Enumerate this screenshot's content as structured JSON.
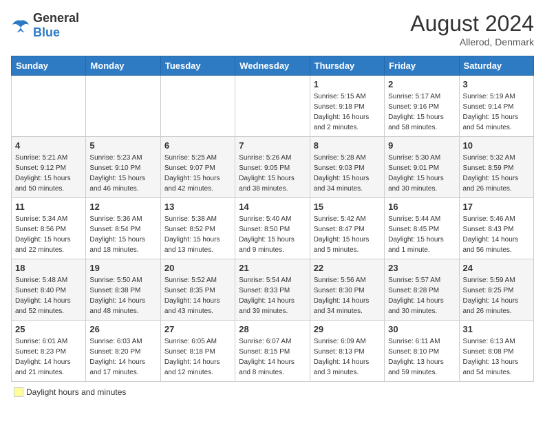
{
  "logo": {
    "general": "General",
    "blue": "Blue"
  },
  "header": {
    "month_year": "August 2024",
    "location": "Allerod, Denmark"
  },
  "days_of_week": [
    "Sunday",
    "Monday",
    "Tuesday",
    "Wednesday",
    "Thursday",
    "Friday",
    "Saturday"
  ],
  "weeks": [
    [
      {
        "day": "",
        "info": ""
      },
      {
        "day": "",
        "info": ""
      },
      {
        "day": "",
        "info": ""
      },
      {
        "day": "",
        "info": ""
      },
      {
        "day": "1",
        "info": "Sunrise: 5:15 AM\nSunset: 9:18 PM\nDaylight: 16 hours\nand 2 minutes."
      },
      {
        "day": "2",
        "info": "Sunrise: 5:17 AM\nSunset: 9:16 PM\nDaylight: 15 hours\nand 58 minutes."
      },
      {
        "day": "3",
        "info": "Sunrise: 5:19 AM\nSunset: 9:14 PM\nDaylight: 15 hours\nand 54 minutes."
      }
    ],
    [
      {
        "day": "4",
        "info": "Sunrise: 5:21 AM\nSunset: 9:12 PM\nDaylight: 15 hours\nand 50 minutes."
      },
      {
        "day": "5",
        "info": "Sunrise: 5:23 AM\nSunset: 9:10 PM\nDaylight: 15 hours\nand 46 minutes."
      },
      {
        "day": "6",
        "info": "Sunrise: 5:25 AM\nSunset: 9:07 PM\nDaylight: 15 hours\nand 42 minutes."
      },
      {
        "day": "7",
        "info": "Sunrise: 5:26 AM\nSunset: 9:05 PM\nDaylight: 15 hours\nand 38 minutes."
      },
      {
        "day": "8",
        "info": "Sunrise: 5:28 AM\nSunset: 9:03 PM\nDaylight: 15 hours\nand 34 minutes."
      },
      {
        "day": "9",
        "info": "Sunrise: 5:30 AM\nSunset: 9:01 PM\nDaylight: 15 hours\nand 30 minutes."
      },
      {
        "day": "10",
        "info": "Sunrise: 5:32 AM\nSunset: 8:59 PM\nDaylight: 15 hours\nand 26 minutes."
      }
    ],
    [
      {
        "day": "11",
        "info": "Sunrise: 5:34 AM\nSunset: 8:56 PM\nDaylight: 15 hours\nand 22 minutes."
      },
      {
        "day": "12",
        "info": "Sunrise: 5:36 AM\nSunset: 8:54 PM\nDaylight: 15 hours\nand 18 minutes."
      },
      {
        "day": "13",
        "info": "Sunrise: 5:38 AM\nSunset: 8:52 PM\nDaylight: 15 hours\nand 13 minutes."
      },
      {
        "day": "14",
        "info": "Sunrise: 5:40 AM\nSunset: 8:50 PM\nDaylight: 15 hours\nand 9 minutes."
      },
      {
        "day": "15",
        "info": "Sunrise: 5:42 AM\nSunset: 8:47 PM\nDaylight: 15 hours\nand 5 minutes."
      },
      {
        "day": "16",
        "info": "Sunrise: 5:44 AM\nSunset: 8:45 PM\nDaylight: 15 hours\nand 1 minute."
      },
      {
        "day": "17",
        "info": "Sunrise: 5:46 AM\nSunset: 8:43 PM\nDaylight: 14 hours\nand 56 minutes."
      }
    ],
    [
      {
        "day": "18",
        "info": "Sunrise: 5:48 AM\nSunset: 8:40 PM\nDaylight: 14 hours\nand 52 minutes."
      },
      {
        "day": "19",
        "info": "Sunrise: 5:50 AM\nSunset: 8:38 PM\nDaylight: 14 hours\nand 48 minutes."
      },
      {
        "day": "20",
        "info": "Sunrise: 5:52 AM\nSunset: 8:35 PM\nDaylight: 14 hours\nand 43 minutes."
      },
      {
        "day": "21",
        "info": "Sunrise: 5:54 AM\nSunset: 8:33 PM\nDaylight: 14 hours\nand 39 minutes."
      },
      {
        "day": "22",
        "info": "Sunrise: 5:56 AM\nSunset: 8:30 PM\nDaylight: 14 hours\nand 34 minutes."
      },
      {
        "day": "23",
        "info": "Sunrise: 5:57 AM\nSunset: 8:28 PM\nDaylight: 14 hours\nand 30 minutes."
      },
      {
        "day": "24",
        "info": "Sunrise: 5:59 AM\nSunset: 8:25 PM\nDaylight: 14 hours\nand 26 minutes."
      }
    ],
    [
      {
        "day": "25",
        "info": "Sunrise: 6:01 AM\nSunset: 8:23 PM\nDaylight: 14 hours\nand 21 minutes."
      },
      {
        "day": "26",
        "info": "Sunrise: 6:03 AM\nSunset: 8:20 PM\nDaylight: 14 hours\nand 17 minutes."
      },
      {
        "day": "27",
        "info": "Sunrise: 6:05 AM\nSunset: 8:18 PM\nDaylight: 14 hours\nand 12 minutes."
      },
      {
        "day": "28",
        "info": "Sunrise: 6:07 AM\nSunset: 8:15 PM\nDaylight: 14 hours\nand 8 minutes."
      },
      {
        "day": "29",
        "info": "Sunrise: 6:09 AM\nSunset: 8:13 PM\nDaylight: 14 hours\nand 3 minutes."
      },
      {
        "day": "30",
        "info": "Sunrise: 6:11 AM\nSunset: 8:10 PM\nDaylight: 13 hours\nand 59 minutes."
      },
      {
        "day": "31",
        "info": "Sunrise: 6:13 AM\nSunset: 8:08 PM\nDaylight: 13 hours\nand 54 minutes."
      }
    ]
  ],
  "legend": {
    "daylight_hours": "Daylight hours",
    "and_minutes": "and minutes"
  }
}
